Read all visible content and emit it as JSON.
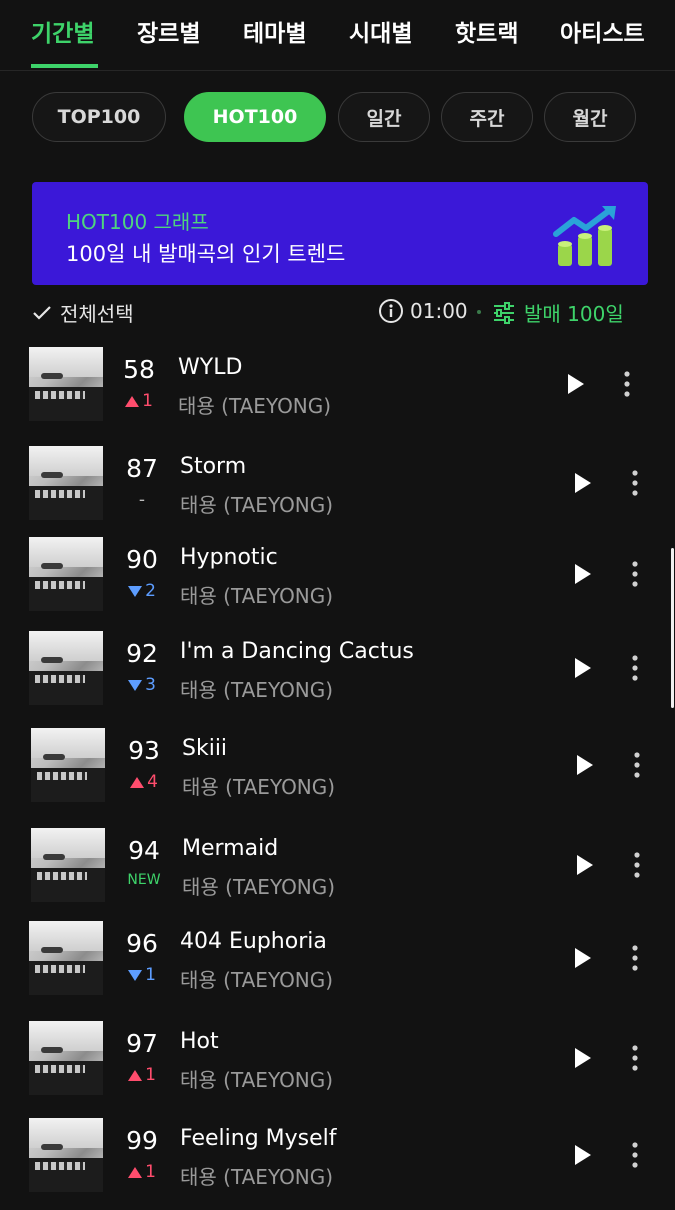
{
  "top_tabs": [
    {
      "label": "기간별",
      "active": true
    },
    {
      "label": "장르별",
      "active": false
    },
    {
      "label": "테마별",
      "active": false
    },
    {
      "label": "시대별",
      "active": false
    },
    {
      "label": "핫트랙",
      "active": false
    },
    {
      "label": "아티스트",
      "active": false
    }
  ],
  "chips": [
    {
      "label": "TOP100",
      "active": false
    },
    {
      "label": "HOT100",
      "active": true
    },
    {
      "label": "일간",
      "active": false
    },
    {
      "label": "주간",
      "active": false
    },
    {
      "label": "월간",
      "active": false
    }
  ],
  "banner": {
    "title": "HOT100 그래프",
    "subtitle": "100일 내 발매곡의 인기 트렌드"
  },
  "toolbar": {
    "select_all": "전체선택",
    "time": "01:00",
    "filter": "발매 100일"
  },
  "colors": {
    "accent": "#3ed36a",
    "banner": "#3b18d8",
    "up": "#ff4d6d",
    "down": "#5d9dff"
  },
  "tracks": [
    {
      "rank": "58",
      "change_type": "up",
      "change": "1",
      "title": "WYLD",
      "artist": "태용 (TAEYONG)"
    },
    {
      "rank": "87",
      "change_type": "same",
      "change": "-",
      "title": "Storm",
      "artist": "태용 (TAEYONG)"
    },
    {
      "rank": "90",
      "change_type": "down",
      "change": "2",
      "title": "Hypnotic",
      "artist": "태용 (TAEYONG)"
    },
    {
      "rank": "92",
      "change_type": "down",
      "change": "3",
      "title": "I'm a Dancing Cactus",
      "artist": "태용 (TAEYONG)"
    },
    {
      "rank": "93",
      "change_type": "up",
      "change": "4",
      "title": "Skiii",
      "artist": "태용 (TAEYONG)"
    },
    {
      "rank": "94",
      "change_type": "new",
      "change": "NEW",
      "title": "Mermaid",
      "artist": "태용 (TAEYONG)"
    },
    {
      "rank": "96",
      "change_type": "down",
      "change": "1",
      "title": "404 Euphoria",
      "artist": "태용 (TAEYONG)"
    },
    {
      "rank": "97",
      "change_type": "up",
      "change": "1",
      "title": "Hot",
      "artist": "태용 (TAEYONG)"
    },
    {
      "rank": "99",
      "change_type": "up",
      "change": "1",
      "title": "Feeling Myself",
      "artist": "태용 (TAEYONG)"
    }
  ]
}
